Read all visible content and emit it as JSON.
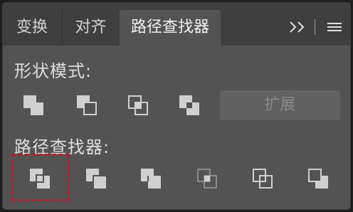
{
  "tabs": [
    {
      "label": "变换"
    },
    {
      "label": "对齐"
    },
    {
      "label": "路径查找器",
      "active": true
    }
  ],
  "header_icons": {
    "collapse": "double-chevron-right-icon",
    "menu": "hamburger-menu-icon"
  },
  "shape_modes": {
    "title": "形状模式:",
    "buttons": [
      "unite-icon",
      "minus-front-icon",
      "intersect-icon",
      "exclude-icon"
    ],
    "expand_label": "扩展"
  },
  "pathfinders": {
    "title": "路径查找器:",
    "buttons": [
      "divide-icon",
      "trim-icon",
      "merge-icon",
      "crop-icon",
      "outline-icon",
      "minus-back-icon"
    ]
  },
  "colors": {
    "panel_bg": "#535353",
    "tabbar_bg": "#3f3f3f",
    "icon_fill": "#d0d0d0",
    "highlight_border": "#b5202a"
  }
}
